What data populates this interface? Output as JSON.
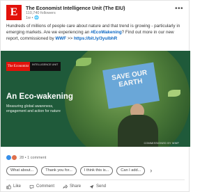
{
  "post": {
    "author": {
      "avatar_letter": "E",
      "name": "The Economist Intelligence Unit (The EIU)",
      "followers": "110,740 followers",
      "time": "1w •",
      "more_label": "•••"
    },
    "text": {
      "body": "Hundreds of millions of people care about nature and that trend is growing - particularly in emerging markets. Are we experiencing an ",
      "hashtag": "#EcoWakening",
      "body2": "? Find out more in our new report, commissioned by ",
      "brand": "WWF",
      "arrow": " >> ",
      "url": "https://bit.ly/3yulbhR"
    },
    "media": {
      "brand_left": "The Economist",
      "brand_right": "INTELLIGENCE UNIT",
      "headline": "An Eco-wakening",
      "subhead": "Measuring global awareness, engagement and action for nature",
      "sign_text": "SAVE OUR EARTH",
      "commissioned": "COMMISSIONED BY WWF"
    },
    "reactions": {
      "summary": "28 • 1 comment",
      "colors": {
        "like": "#378fe9",
        "love": "#df704d"
      }
    },
    "suggestions": [
      "What about...",
      "Thank you for...",
      "I think this is...",
      "Can I add..."
    ],
    "suggestions_next": "›",
    "actions": [
      {
        "label": "Like",
        "icon": "thumbs-up-icon"
      },
      {
        "label": "Comment",
        "icon": "comment-icon"
      },
      {
        "label": "Share",
        "icon": "share-icon"
      },
      {
        "label": "Send",
        "icon": "send-icon"
      }
    ]
  },
  "colors": {
    "brand_red": "#e3120b",
    "link": "#0a66c2",
    "media_bg": "#1f5a3a"
  }
}
